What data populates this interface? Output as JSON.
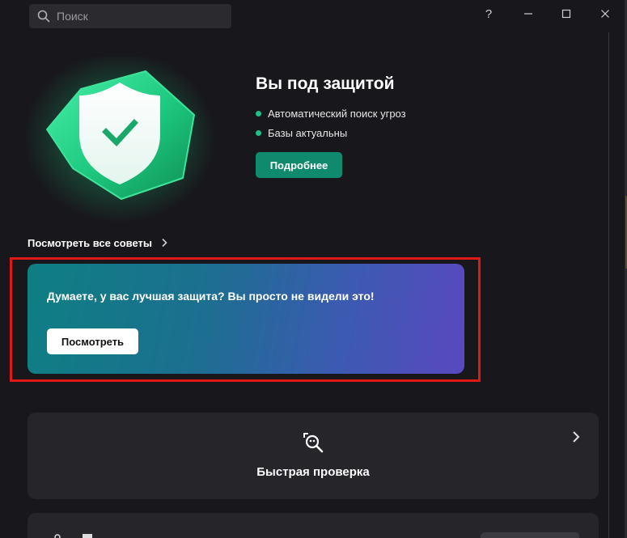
{
  "titlebar": {
    "search_placeholder": "Поиск",
    "help_glyph": "?",
    "minimize_glyph": "—"
  },
  "status": {
    "title": "Вы под защитой",
    "items": [
      "Автоматический поиск угроз",
      "Базы актуальны"
    ],
    "details_button": "Подробнее",
    "accent_color": "#1fbf85"
  },
  "tips": {
    "link_label": "Посмотреть все советы"
  },
  "promo": {
    "text": "Думаете, у вас лучшая защита? Вы просто не видели это!",
    "button": "Посмотреть"
  },
  "quick_scan": {
    "title": "Быстрая проверка",
    "icon": "magnifier-scan-icon"
  }
}
